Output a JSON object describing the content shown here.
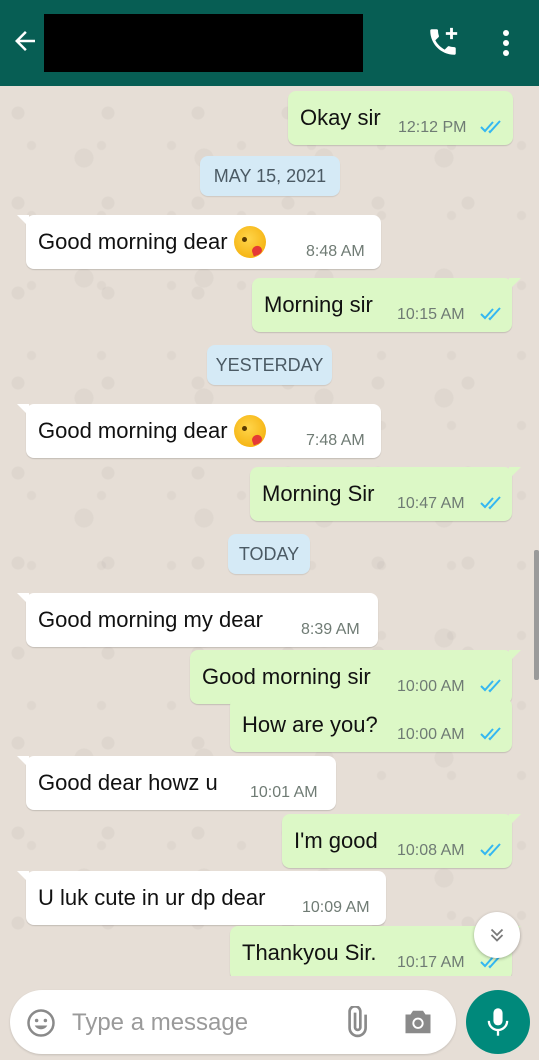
{
  "header": {
    "contact_name": ""
  },
  "conversation": [
    {
      "type": "msg",
      "dir": "out",
      "text": "Okay sir",
      "time": "12:12 PM",
      "read": true
    },
    {
      "type": "date",
      "label": "MAY 15, 2021"
    },
    {
      "type": "msg",
      "dir": "in",
      "text": "Good morning dear",
      "emoji": "kissing-heart-emoji",
      "time": "8:48 AM"
    },
    {
      "type": "msg",
      "dir": "out",
      "text": "Morning sir",
      "time": "10:15 AM",
      "read": true
    },
    {
      "type": "date",
      "label": "YESTERDAY"
    },
    {
      "type": "msg",
      "dir": "in",
      "text": "Good morning dear",
      "emoji": "kissing-heart-emoji",
      "time": "7:48 AM"
    },
    {
      "type": "msg",
      "dir": "out",
      "text": "Morning Sir",
      "time": "10:47 AM",
      "read": true
    },
    {
      "type": "date",
      "label": "TODAY"
    },
    {
      "type": "msg",
      "dir": "in",
      "text": "Good morning my dear",
      "time": "8:39 AM"
    },
    {
      "type": "msg",
      "dir": "out",
      "text": "Good morning sir",
      "time": "10:00 AM",
      "read": true
    },
    {
      "type": "msg",
      "dir": "out",
      "text": "How are you?",
      "time": "10:00 AM",
      "read": true
    },
    {
      "type": "msg",
      "dir": "in",
      "text": "Good dear howz u",
      "time": "10:01 AM"
    },
    {
      "type": "msg",
      "dir": "out",
      "text": "I'm good",
      "time": "10:08 AM",
      "read": true
    },
    {
      "type": "msg",
      "dir": "in",
      "text": "U luk cute in ur dp dear",
      "time": "10:09 AM"
    },
    {
      "type": "msg",
      "dir": "out",
      "text": "Thankyou Sir.",
      "time": "10:17 AM",
      "read": true
    }
  ],
  "composer": {
    "placeholder": "Type a message"
  },
  "colors": {
    "header": "#075e54",
    "outgoing_bubble": "#dcf8c6",
    "incoming_bubble": "#ffffff",
    "date_pill": "#d5eaf6",
    "read_ticks": "#34b7f1",
    "mic_button": "#00897b"
  },
  "icons": [
    "back-arrow-icon",
    "add-call-icon",
    "more-options-icon",
    "emoji-icon",
    "attach-icon",
    "camera-icon",
    "mic-icon",
    "scroll-down-icon"
  ]
}
